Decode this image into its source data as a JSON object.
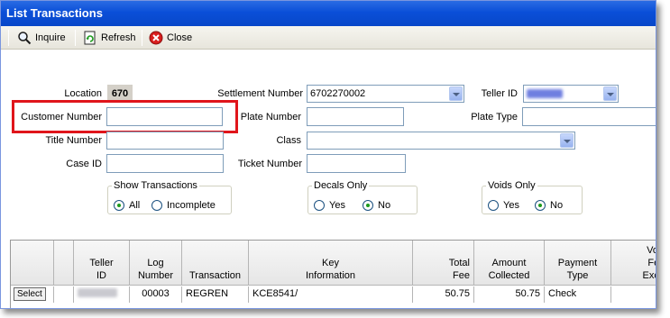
{
  "window": {
    "title": "List Transactions"
  },
  "toolbar": {
    "inquire": "Inquire",
    "refresh": "Refresh",
    "close": "Close"
  },
  "form": {
    "location_label": "Location",
    "location_value": "670",
    "settlement_label": "Settlement Number",
    "settlement_value": "6702270002",
    "teller_label": "Teller ID",
    "customer_label": "Customer Number",
    "customer_value": "",
    "plate_number_label": "Plate Number",
    "plate_type_label": "Plate Type",
    "title_label": "Title Number",
    "class_label": "Class",
    "caseid_label": "Case ID",
    "ticket_label": "Ticket Number"
  },
  "show_transactions": {
    "legend": "Show Transactions",
    "opt1": "All",
    "opt2": "Incomplete",
    "selected": "All"
  },
  "decals_only": {
    "legend": "Decals Only",
    "opt1": "Yes",
    "opt2": "No",
    "selected": "No"
  },
  "voids_only": {
    "legend": "Voids Only",
    "opt1": "Yes",
    "opt2": "No",
    "selected": "No"
  },
  "grid": {
    "headers": [
      "Teller\nID",
      "Log\nNumber",
      "Transaction",
      "Key\nInformation",
      "Total\nFee",
      "Amount\nCollected",
      "Payment\nType",
      "Voi\nFe\nExce"
    ],
    "rows": [
      {
        "select_label": "Select",
        "log": "00003",
        "transaction": "REGREN",
        "key": "KCE8541/",
        "fee": "50.75",
        "collected": "50.75",
        "payment": "Check"
      }
    ]
  },
  "colors": {
    "highlight": "#e0151b",
    "titlebar": "#0a4fd8"
  }
}
